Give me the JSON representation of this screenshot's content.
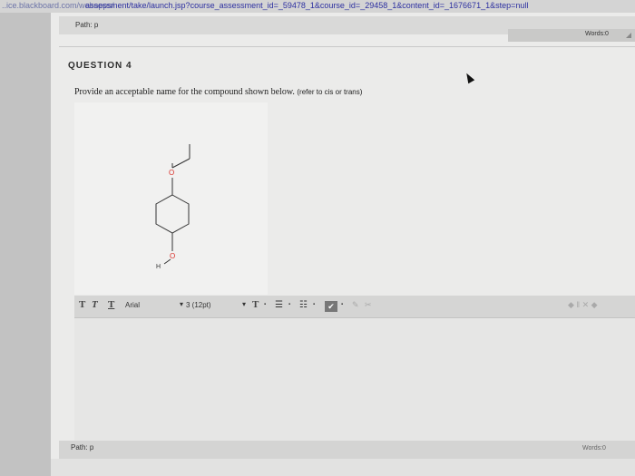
{
  "browser": {
    "url_host": "..ice.blackboard.com/webapps/",
    "url_path": "assessment/take/launch.jsp?course_assessment_id=_59478_1&course_id=_29458_1&content_id=_1676671_1&step=null"
  },
  "top_editor": {
    "path_label": "Path: p",
    "words_label": "Words:0"
  },
  "question": {
    "title": "QUESTION 4",
    "prompt": "Provide an acceptable name for the compound shown below.",
    "hint": "(refer to cis or trans)"
  },
  "molecule_labels": {
    "ether_oxygen": "O",
    "hydroxyl_oxygen": "O",
    "hydroxyl_h": "H"
  },
  "toolbar": {
    "bold_glyph": "T",
    "italic_glyph": "T",
    "underline_glyph": "T",
    "font_family": "Arial",
    "font_size": "3 (12pt)",
    "text_color_glyph": "T",
    "dropdown_glyph": "▾",
    "small_dropdown_glyph": "▪",
    "list_glyph_1": "☰",
    "list_glyph_2": "☷",
    "swatch_glyph": "✔",
    "link_glyph": "✎",
    "unlink_glyph": "✂",
    "right_icons": "◆ ‖ ✕ ◆"
  },
  "bottom_editor": {
    "path_label": "Path: p",
    "words_label": "Words:0"
  },
  "colors": {
    "accent_link": "#2c2fa0",
    "oxygen": "#d9302a"
  },
  "icons": {
    "cursor": "mouse-pointer-icon",
    "resize": "resize-grip-icon"
  }
}
